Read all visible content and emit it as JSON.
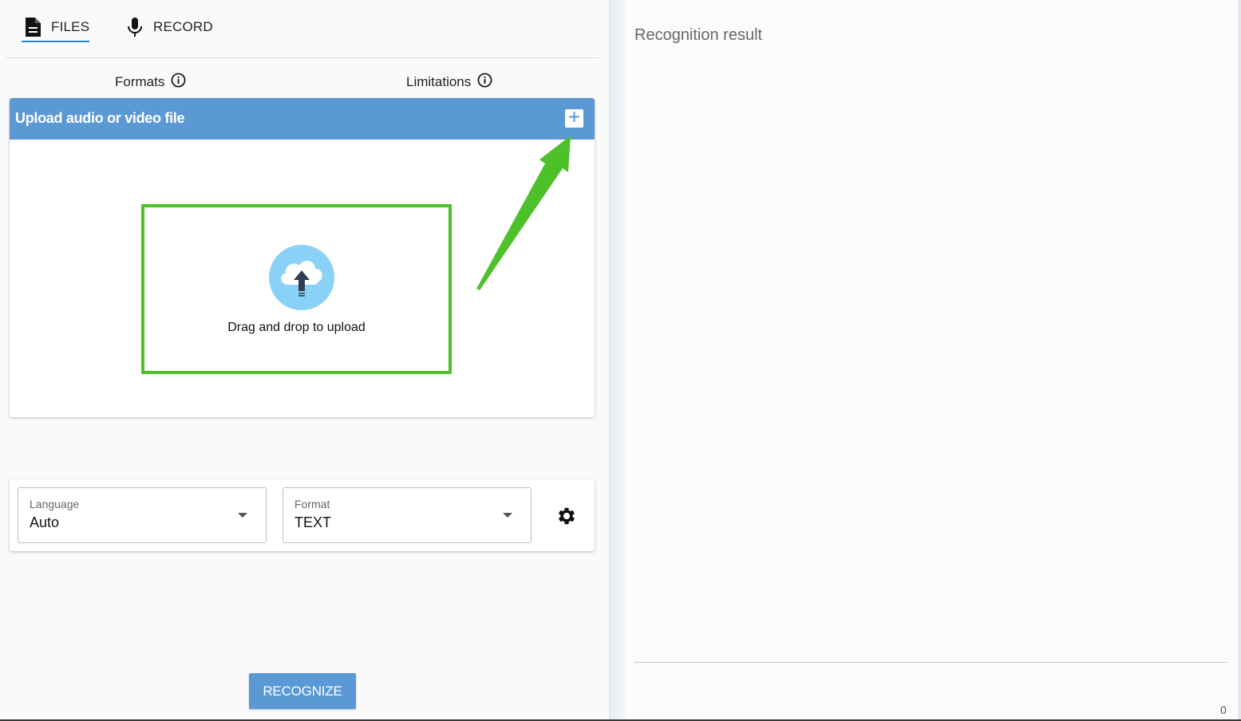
{
  "tabs": {
    "files_label": "FILES",
    "record_label": "RECORD",
    "active": "FILES"
  },
  "info": {
    "formats_label": "Formats",
    "limitations_label": "Limitations"
  },
  "upload": {
    "title": "Upload audio or video file",
    "drop_text": "Drag and drop to upload"
  },
  "settings": {
    "language": {
      "label": "Language",
      "value": "Auto"
    },
    "format": {
      "label": "Format",
      "value": "TEXT"
    }
  },
  "actions": {
    "recognize_label": "RECOGNIZE"
  },
  "result": {
    "title": "Recognition result",
    "char_count": "0"
  },
  "icons": {
    "files_tab": "file-document-icon",
    "record_tab": "microphone-icon",
    "info": "info-circle-icon",
    "add": "plus-icon",
    "upload": "cloud-upload-icon",
    "settings": "gear-icon"
  },
  "colors": {
    "accent": "#5b99d4",
    "tab_underline": "#2d86d4",
    "highlight_green": "#4ec02a",
    "cloud": "#89d1f7"
  }
}
